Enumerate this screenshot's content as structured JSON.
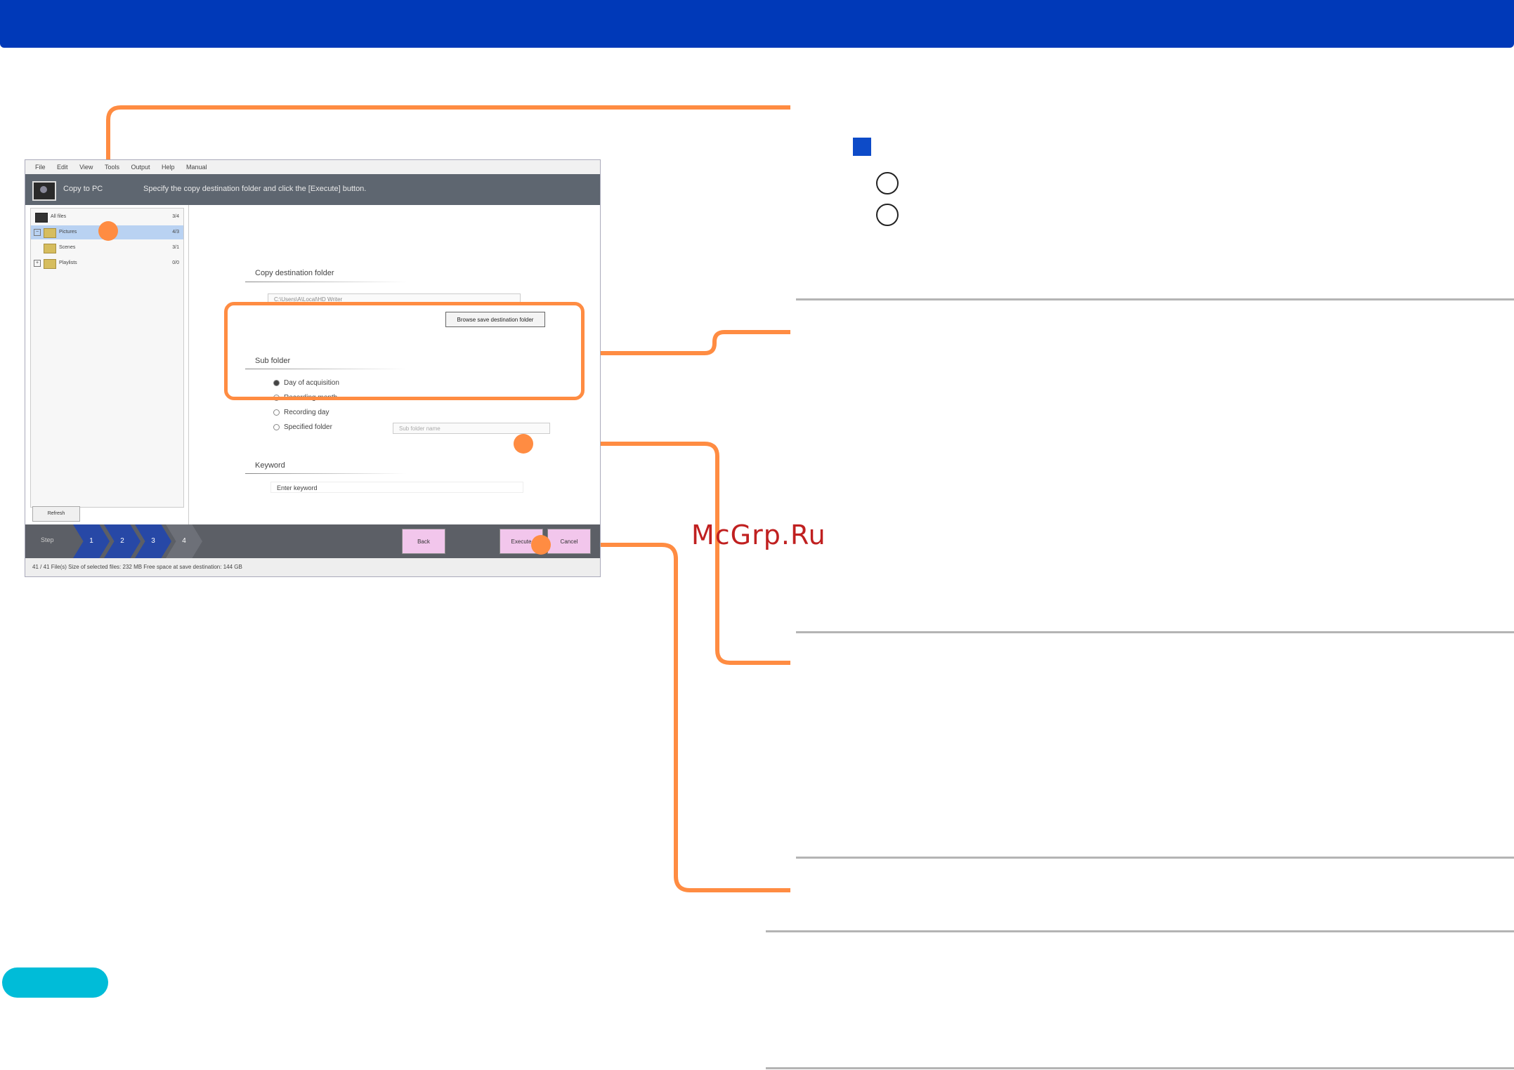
{
  "app": {
    "menu": [
      "File",
      "Edit",
      "View",
      "Tools",
      "Output",
      "Help",
      "Manual"
    ],
    "title": "Copy to PC",
    "instruction": "Specify the copy destination folder and click the [Execute] button."
  },
  "sidebar": {
    "items": [
      {
        "label": "All files",
        "count": "3/4"
      },
      {
        "label": "Pictures",
        "count": "4/3"
      },
      {
        "label": "Scenes",
        "count": "3/1"
      },
      {
        "label": "Playlists",
        "count": "0/0"
      }
    ],
    "refresh_label": "Refresh"
  },
  "form": {
    "copy_destination": {
      "label": "Copy destination folder",
      "path": "C:\\Users\\A\\Local\\HD Writer",
      "browse_label": "Browse save destination folder"
    },
    "sub_folder": {
      "label": "Sub folder",
      "options": [
        "Day of acquisition",
        "Recording month",
        "Recording day",
        "Specified folder"
      ],
      "selected": "Day of acquisition",
      "name_placeholder": "Sub folder name"
    },
    "keyword": {
      "label": "Keyword",
      "placeholder": "Enter keyword"
    }
  },
  "footer": {
    "step_label": "Step",
    "steps": [
      "1",
      "2",
      "3",
      "4"
    ],
    "back_label": "Back",
    "execute_label": "Execute",
    "cancel_label": "Cancel"
  },
  "status": {
    "text": "41 / 41 File(s)  Size of selected files: 232 MB  Free space at save destination: 144 GB"
  },
  "watermark": "McGrp.Ru",
  "colors": {
    "header_bar": "#0039b8",
    "callout": "#ff8c42",
    "marker_square": "#0d4bc8",
    "pill": "#00bcd8",
    "watermark": "#c02020"
  }
}
